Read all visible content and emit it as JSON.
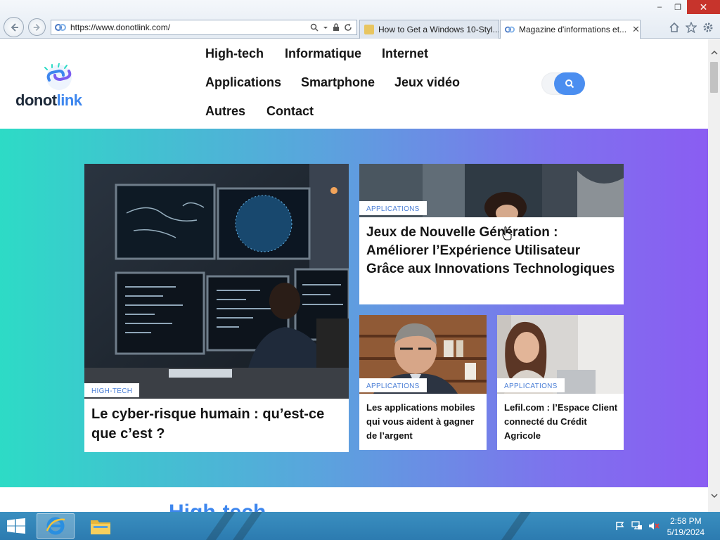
{
  "window": {
    "minimize": "–",
    "restore": "❐",
    "close": "✕"
  },
  "browser": {
    "back_icon": "arrow-left-icon",
    "forward_icon": "arrow-right-icon",
    "address": "https://www.donotlink.com/",
    "tabs": [
      {
        "label": "How to Get a Windows 10-Styl...",
        "active": false
      },
      {
        "label": "Magazine d'informations et...",
        "active": true
      }
    ],
    "tab_close": "✕"
  },
  "site": {
    "logo_part1": "donot",
    "logo_part2": "link",
    "nav": [
      "High-tech",
      "Informatique",
      "Internet",
      "Applications",
      "Smartphone",
      "Jeux vidéo",
      "Autres",
      "Contact"
    ]
  },
  "articles": {
    "main": {
      "category": "HIGH-TECH",
      "title": "Le cyber-risque humain : qu’est-ce que c’est ?"
    },
    "top_right": {
      "category": "APPLICATIONS",
      "title": "Jeux de Nouvelle Génération : Améliorer l’Expérience Utilisateur Grâce aux Innovations Technologiques"
    },
    "bottom_left": {
      "category": "APPLICATIONS",
      "title": "Les applications mobiles qui vous aident à gagner de l’argent"
    },
    "bottom_right": {
      "category": "APPLICATIONS",
      "title": "Lefil.com : l’Espace Client connecté du Crédit Agricole"
    }
  },
  "section_peek": "High-tech",
  "taskbar": {
    "time": "2:58 PM",
    "date": "5/19/2024"
  },
  "colors": {
    "accent": "#3d86ee",
    "hero_start": "#2ddbc6",
    "hero_end": "#8a5df2",
    "taskbar": "#2c7bb0",
    "close_btn": "#c7342c"
  }
}
